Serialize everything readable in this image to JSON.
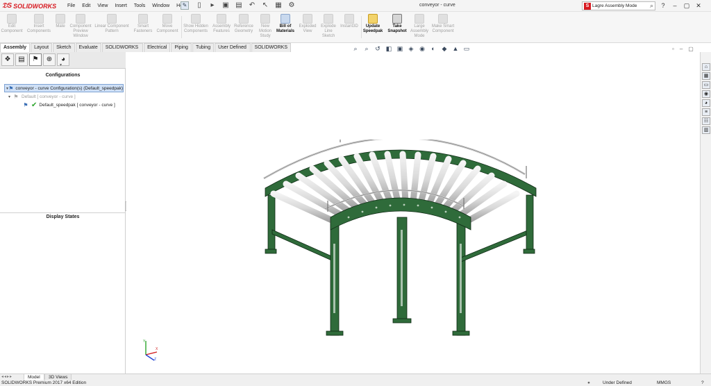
{
  "app": {
    "name": "SOLIDWORKS",
    "document_title": "conveyor - curve"
  },
  "menu": [
    "File",
    "Edit",
    "View",
    "Insert",
    "Tools",
    "Window",
    "Help"
  ],
  "search": {
    "value": "Lagre Assembly Mode"
  },
  "ribbon": {
    "commands": [
      {
        "label": "Edit Component",
        "enabled": false
      },
      {
        "label": "Insert Components",
        "enabled": false
      },
      {
        "label": "Mate",
        "enabled": false
      },
      {
        "label": "Component Preview Window",
        "enabled": false
      },
      {
        "label": "Linear Component Pattern",
        "enabled": false
      },
      {
        "label": "Smart Fasteners",
        "enabled": false
      },
      {
        "label": "Move Component",
        "enabled": false
      },
      {
        "label": "Show Hidden Components",
        "enabled": false
      },
      {
        "label": "Assembly Features",
        "enabled": false
      },
      {
        "label": "Reference Geometry",
        "enabled": false
      },
      {
        "label": "New Motion Study",
        "enabled": false
      },
      {
        "label": "Bill of Materials",
        "enabled": true
      },
      {
        "label": "Exploded View",
        "enabled": false
      },
      {
        "label": "Explode Line Sketch",
        "enabled": false
      },
      {
        "label": "Instant3D",
        "enabled": false
      },
      {
        "label": "Update Speedpak",
        "enabled": true
      },
      {
        "label": "Take Snapshot",
        "enabled": true
      },
      {
        "label": "Large Assembly Mode",
        "enabled": false
      },
      {
        "label": "Make Smart Component",
        "enabled": false
      }
    ]
  },
  "tabs": [
    "Assembly",
    "Layout",
    "Sketch",
    "Evaluate",
    "SOLIDWORKS Add-Ins",
    "Electrical",
    "Piping",
    "Tubing",
    "User Defined Route",
    "SOLIDWORKS MBD"
  ],
  "panel": {
    "configurations_title": "Configurations",
    "display_states_title": "Display States",
    "tree": {
      "root": "conveyor - curve Configuration(s)  (Default_speedpak)",
      "child": "Default [ conveyor - curve ]",
      "grandchild": "Default_speedpak [ conveyor - curve ]"
    }
  },
  "bottom_tabs": [
    "Model",
    "3D Views"
  ],
  "status": {
    "edition": "SOLIDWORKS Premium 2017 x64 Edition",
    "state": "Under Defined",
    "units": "MMGS"
  },
  "colors": {
    "frame_green": "#2f6b3a",
    "roller_gray": "#d9d9d9",
    "brand_red": "#d71920",
    "selection_blue": "#cfe0f6"
  }
}
